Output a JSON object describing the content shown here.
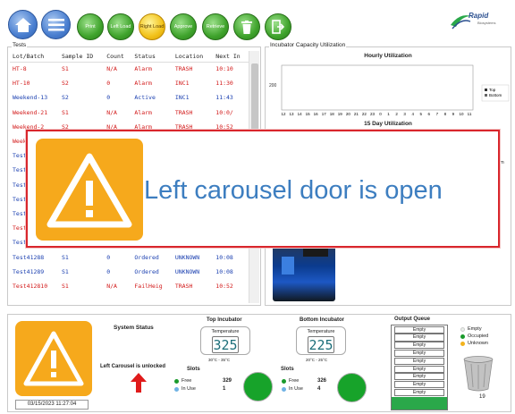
{
  "toolbar": {
    "buttons": [
      {
        "label": "",
        "icon": "home-icon"
      },
      {
        "label": "",
        "icon": "menu-icon"
      },
      {
        "label": "Print"
      },
      {
        "label": "Left Load"
      },
      {
        "label": "Right Load"
      },
      {
        "label": "Approve"
      },
      {
        "label": "Retrieve"
      },
      {
        "label": "",
        "icon": "trash-icon"
      },
      {
        "label": "",
        "icon": "exit-door-icon"
      }
    ],
    "logo": {
      "name": "Rapid",
      "sub": "Biosystems"
    }
  },
  "tests": {
    "title": "Tests",
    "columns": [
      "Lot/Batch",
      "Sample ID",
      "Count",
      "Status",
      "Location",
      "Next In"
    ],
    "rows": [
      {
        "lot": "HT-8",
        "sample": "S1",
        "count": "N/A",
        "status": "Alarm",
        "location": "TRASH",
        "next": "10:10",
        "color": "red"
      },
      {
        "lot": "HT-10",
        "sample": "S2",
        "count": "0",
        "status": "Alarm",
        "location": "INC1",
        "next": "11:30",
        "color": "red"
      },
      {
        "lot": "Weekend-13",
        "sample": "S2",
        "count": "0",
        "status": "Active",
        "location": "INC1",
        "next": "11:43",
        "color": "blue"
      },
      {
        "lot": "Weekend-21",
        "sample": "S1",
        "count": "N/A",
        "status": "Alarm",
        "location": "TRASH",
        "next": "10:0/",
        "color": "red"
      },
      {
        "lot": "Weekend-2",
        "sample": "S2",
        "count": "N/A",
        "status": "Alarm",
        "location": "TRASH",
        "next": "10:52",
        "color": "red"
      },
      {
        "lot": "Week",
        "sample": "",
        "count": "",
        "status": "",
        "location": "",
        "next": "",
        "color": "red"
      },
      {
        "lot": "Test",
        "sample": "",
        "count": "",
        "status": "",
        "location": "",
        "next": "",
        "color": "blue"
      },
      {
        "lot": "Test",
        "sample": "",
        "count": "",
        "status": "",
        "location": "",
        "next": "",
        "color": "blue"
      },
      {
        "lot": "Test",
        "sample": "",
        "count": "",
        "status": "",
        "location": "",
        "next": "",
        "color": "blue"
      },
      {
        "lot": "Test",
        "sample": "",
        "count": "",
        "status": "",
        "location": "",
        "next": "",
        "color": "blue"
      },
      {
        "lot": "Test",
        "sample": "",
        "count": "",
        "status": "",
        "location": "",
        "next": "",
        "color": "blue"
      },
      {
        "lot": "Test",
        "sample": "",
        "count": "",
        "status": "",
        "location": "",
        "next": "",
        "color": "red"
      },
      {
        "lot": "Test41287",
        "sample": "S1",
        "count": "0",
        "status": "Ordered",
        "location": "UNKNOWN",
        "next": "10:08",
        "color": "blue"
      },
      {
        "lot": "Test41288",
        "sample": "S1",
        "count": "0",
        "status": "Ordered",
        "location": "UNKNOWN",
        "next": "10:08",
        "color": "blue"
      },
      {
        "lot": "Test41289",
        "sample": "S1",
        "count": "0",
        "status": "Ordered",
        "location": "UNKNOWN",
        "next": "10:08",
        "color": "blue"
      },
      {
        "lot": "Test412810",
        "sample": "S1",
        "count": "N/A",
        "status": "FailHeig",
        "location": "TRASH",
        "next": "10:52",
        "color": "red"
      }
    ]
  },
  "utilization": {
    "title": "Incubator Capacity Utilization",
    "hourly_title": "Hourly Utilization",
    "daily_title": "15 Day Utilization",
    "legend": [
      "Top",
      "Bottom"
    ],
    "stub_label": "ttom"
  },
  "chart_data": {
    "type": "line",
    "title": "Hourly Utilization",
    "categories": [
      "12",
      "13",
      "14",
      "15",
      "16",
      "17",
      "18",
      "19",
      "20",
      "21",
      "22",
      "23",
      "0",
      "1",
      "2",
      "3",
      "4",
      "5",
      "6",
      "7",
      "8",
      "9",
      "10",
      "11"
    ],
    "series": [
      {
        "name": "Top",
        "values": []
      },
      {
        "name": "Bottom",
        "values": []
      }
    ],
    "ytick": "200",
    "legend": "right",
    "colors": {
      "top": "#333333",
      "bottom": "#666666"
    }
  },
  "status": {
    "system_title": "System Status",
    "system_message": "Left Carousel is unlocked",
    "datetime": "03/15/2023  11:27:04",
    "top": {
      "title": "Top Incubator",
      "temp_label": "Temperature",
      "temp": "325",
      "range": "30°C - 35°C",
      "free": "329",
      "inuse": "1"
    },
    "bottom": {
      "title": "Bottom Incubator",
      "temp_label": "Temperature",
      "temp": "225",
      "range": "20°C - 25°C",
      "free": "326",
      "inuse": "4"
    },
    "slots_label": "Slots",
    "free_label": "Free",
    "inuse_label": "In Use",
    "queue": {
      "title": "Output Queue",
      "items": [
        "Empty",
        "Empty",
        "Empty",
        "Empty",
        "Empty",
        "Empty",
        "Empty",
        "Empty",
        "Empty",
        "Empty"
      ],
      "legend": [
        "Empty",
        "Occupied",
        "Unknown"
      ],
      "bin_count": "19"
    }
  },
  "alert": {
    "message": "Left carousel door is open",
    "color": "#3d7ec0",
    "border": "#d9262c",
    "icon": "warning-icon"
  }
}
